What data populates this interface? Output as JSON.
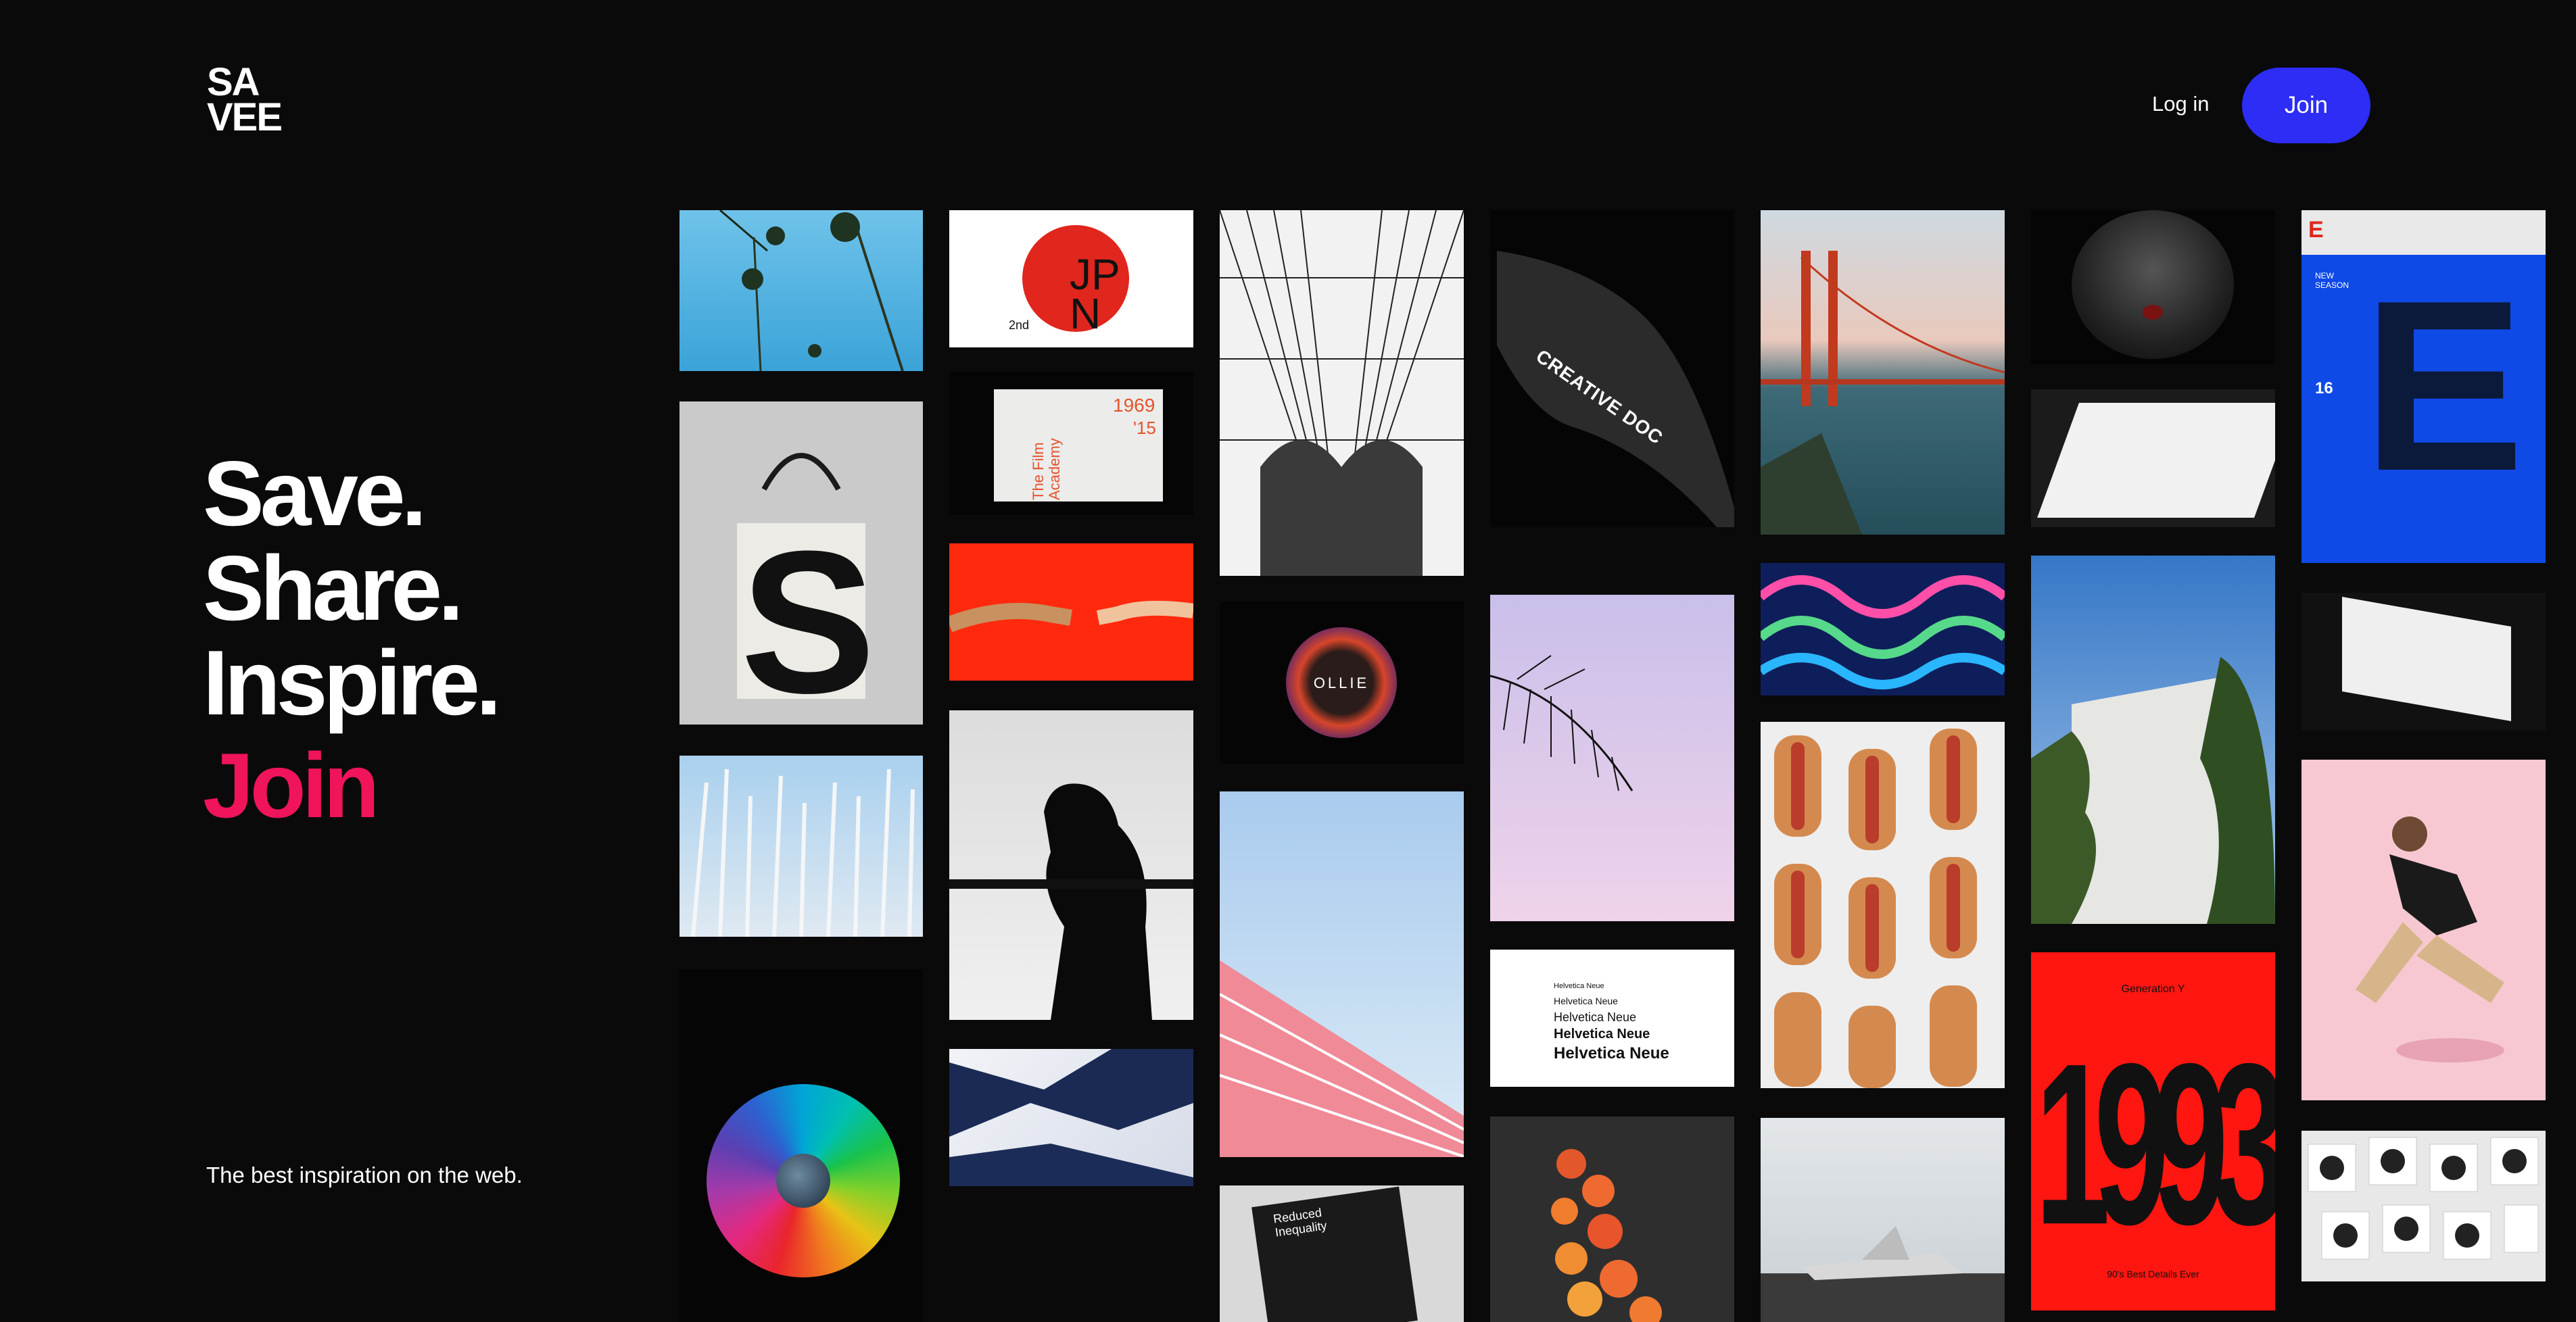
{
  "header": {
    "logo_line1": "SA",
    "logo_line2": "VEE",
    "login_label": "Log in",
    "join_label": "Join"
  },
  "hero": {
    "line1": "Save.",
    "line2": "Share.",
    "line3": "Inspire.",
    "cta": "Join"
  },
  "tagline": "The best inspiration on the web.",
  "tiles_text": {
    "jpn": "JP N",
    "jpn_2nd": "2nd",
    "film_year": "1969",
    "film_year2": "'15",
    "film_academy": "The Film Academy",
    "creative_doc": "CREATIVE DOC",
    "ollie": "OLLIE",
    "helvetica": [
      "Helvetica Neue",
      "Helvetica Neue",
      "Helvetica Neue",
      "Helvetica Neue",
      "Helvetica Neue"
    ],
    "poster_1993": "1993",
    "poster_top": "Generation Y",
    "poster_bottom": "90's Best Details Ever",
    "mag_letter": "E",
    "mag_num": "16",
    "mag_season": "NEW SEASON",
    "s_letter": "S",
    "booklet_title": "Reduced Inequality"
  },
  "colors": {
    "background": "#0a0a0a",
    "join_button": "#2d2df5",
    "accent": "#f0145a"
  }
}
